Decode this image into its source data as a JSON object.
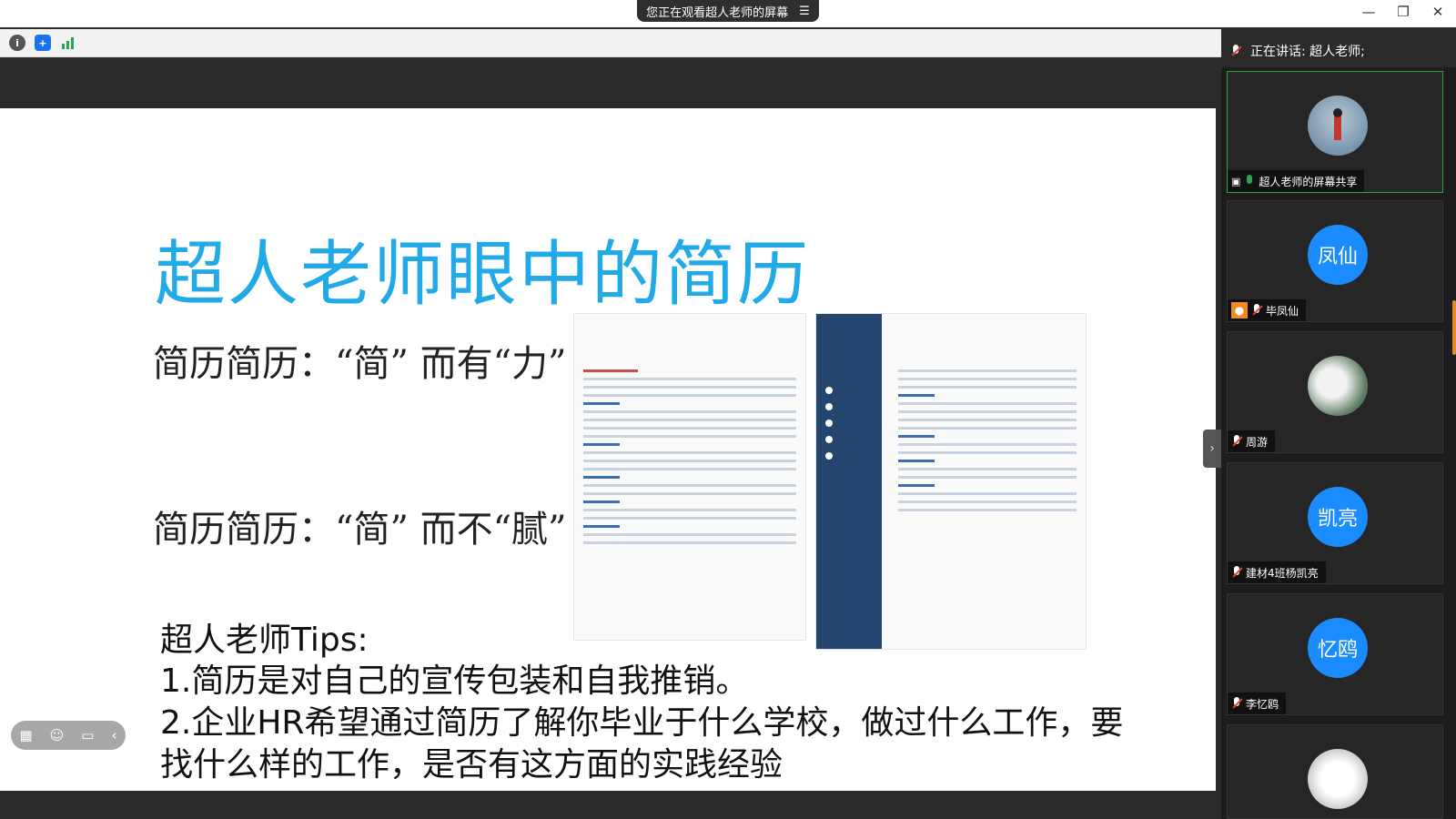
{
  "titlebar": {
    "share_banner": "您正在观看超人老师的屏幕",
    "menu_icon": "menu-icon",
    "controls": [
      "—",
      "❐",
      "✕"
    ]
  },
  "infobar": {
    "icons": [
      "info-icon",
      "shield-icon",
      "signal-icon"
    ]
  },
  "slide": {
    "title": "超人老师眼中的简历",
    "line1": "简历简历：“简” 而有“力”",
    "line2": "简历简历：“简” 而不“腻”",
    "tips_title": "超人老师Tips:",
    "tip1": "1.简历是对自己的宣传包装和自我推销。",
    "tip2a": "2.企业HR希望通过简历了解你毕业于什么学校，做过什么工作，要",
    "tip2b": "找什么样的工作，是否有这方面的实践经验"
  },
  "float_toolbar": {
    "icons": [
      "grid-icon",
      "emoji-icon",
      "chat-icon",
      "collapse-icon"
    ]
  },
  "panel": {
    "speaking_label": "正在讲话: 超人老师;",
    "participants": [
      {
        "avatar_text": "",
        "name": "超人老师的屏幕共享",
        "mic": "on",
        "type": "image"
      },
      {
        "avatar_text": "凤仙",
        "name": "毕凤仙",
        "mic": "off",
        "type": "text"
      },
      {
        "avatar_text": "",
        "name": "周游",
        "mic": "off",
        "type": "image"
      },
      {
        "avatar_text": "凯亮",
        "name": "建材4班杨凯亮",
        "mic": "off",
        "type": "text"
      },
      {
        "avatar_text": "忆鸥",
        "name": "李忆鸥",
        "mic": "off",
        "type": "text"
      },
      {
        "avatar_text": "",
        "name": "",
        "mic": "off",
        "type": "image"
      }
    ]
  },
  "colors": {
    "title_blue": "#22aae8",
    "avatar_blue": "#1a8cff",
    "active_green": "#2ea34a",
    "resume_navy": "#24466e"
  }
}
